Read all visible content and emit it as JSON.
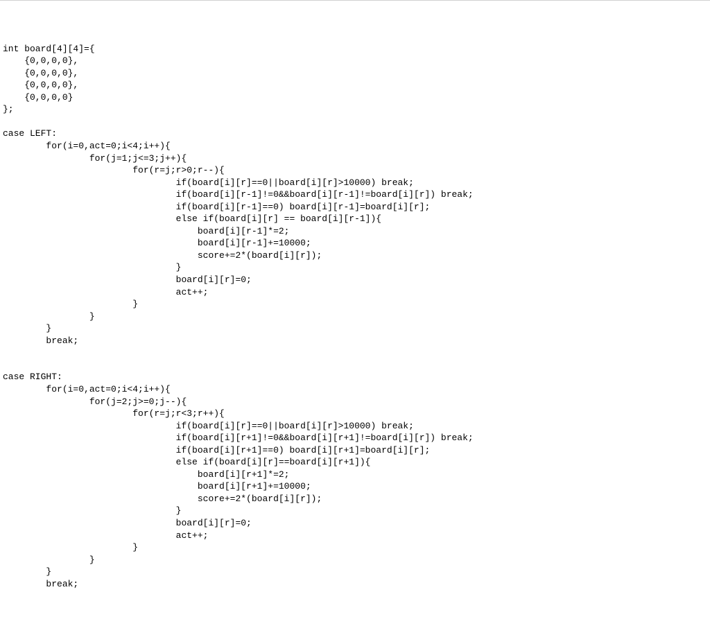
{
  "code": "int board[4][4]={\n    {0,0,0,0},\n    {0,0,0,0},\n    {0,0,0,0},\n    {0,0,0,0}\n};\n\ncase LEFT:\n        for(i=0,act=0;i<4;i++){\n                for(j=1;j<=3;j++){\n                        for(r=j;r>0;r--){\n                                if(board[i][r]==0||board[i][r]>10000) break;\n                                if(board[i][r-1]!=0&&board[i][r-1]!=board[i][r]) break;\n                                if(board[i][r-1]==0) board[i][r-1]=board[i][r];\n                                else if(board[i][r] == board[i][r-1]){\n                                    board[i][r-1]*=2;\n                                    board[i][r-1]+=10000;\n                                    score+=2*(board[i][r]);\n                                }\n                                board[i][r]=0;\n                                act++;\n                        }\n                }\n        }\n        break;\n\n\ncase RIGHT:\n        for(i=0,act=0;i<4;i++){\n                for(j=2;j>=0;j--){\n                        for(r=j;r<3;r++){\n                                if(board[i][r]==0||board[i][r]>10000) break;\n                                if(board[i][r+1]!=0&&board[i][r+1]!=board[i][r]) break;\n                                if(board[i][r+1]==0) board[i][r+1]=board[i][r];\n                                else if(board[i][r]==board[i][r+1]){\n                                    board[i][r+1]*=2;\n                                    board[i][r+1]+=10000;\n                                    score+=2*(board[i][r]);\n                                }\n                                board[i][r]=0;\n                                act++;\n                        }\n                }\n        }\n        break;"
}
